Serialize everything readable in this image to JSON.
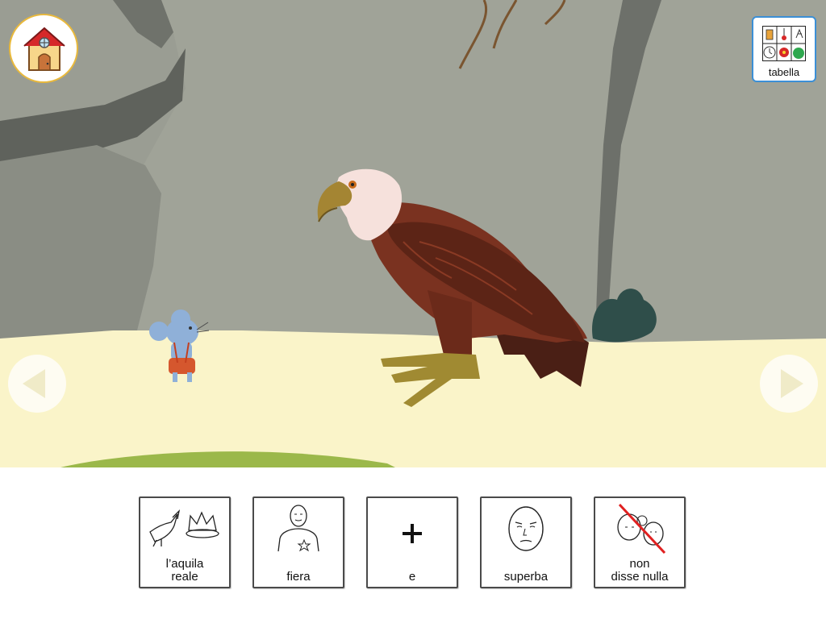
{
  "toolbar": {
    "home_icon": "house-icon",
    "tabella_icon": "symbol-grid-icon",
    "tabella_label": "tabella"
  },
  "navigation": {
    "prev_icon": "arrow-left-icon",
    "next_icon": "arrow-right-icon"
  },
  "sentence": {
    "tiles": [
      {
        "icon": "eagle-crown-symbol",
        "lines": [
          "l’aquila",
          "reale"
        ]
      },
      {
        "icon": "proud-person-symbol",
        "lines": [
          "fiera"
        ]
      },
      {
        "icon": "plus-symbol",
        "lines": [
          "e"
        ]
      },
      {
        "icon": "haughty-face-symbol",
        "lines": [
          "superba"
        ]
      },
      {
        "icon": "said-nothing-symbol",
        "lines": [
          "non",
          "disse nulla"
        ]
      }
    ]
  },
  "colors": {
    "home_border": "#e9b93c",
    "tabella_border": "#3b8fd6",
    "rock": "#a0a398",
    "ground": "#faf4c9"
  }
}
